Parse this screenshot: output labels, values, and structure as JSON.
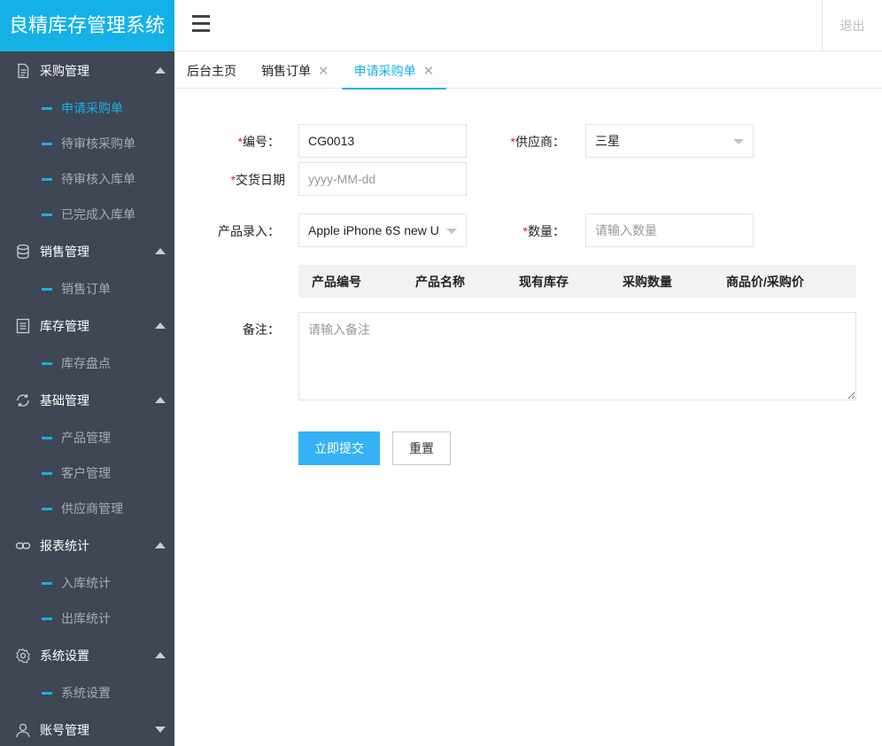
{
  "app": {
    "title": "良精库存管理系统",
    "logout": "退出"
  },
  "sidebar": {
    "groups": [
      {
        "label": "采购管理",
        "icon": "document-icon",
        "expanded": true,
        "items": [
          {
            "label": "申请采购单",
            "active": true
          },
          {
            "label": "待审核采购单"
          },
          {
            "label": "待审核入库单"
          },
          {
            "label": "已完成入库单"
          }
        ]
      },
      {
        "label": "销售管理",
        "icon": "database-icon",
        "expanded": true,
        "items": [
          {
            "label": "销售订单"
          }
        ]
      },
      {
        "label": "库存管理",
        "icon": "list-icon",
        "expanded": true,
        "items": [
          {
            "label": "库存盘点"
          }
        ]
      },
      {
        "label": "基础管理",
        "icon": "refresh-icon",
        "expanded": true,
        "items": [
          {
            "label": "产品管理"
          },
          {
            "label": "客户管理"
          },
          {
            "label": "供应商管理"
          }
        ]
      },
      {
        "label": "报表统计",
        "icon": "link-icon",
        "expanded": true,
        "items": [
          {
            "label": "入库统计"
          },
          {
            "label": "出库统计"
          }
        ]
      },
      {
        "label": "系统设置",
        "icon": "gear-icon",
        "expanded": true,
        "items": [
          {
            "label": "系统设置"
          }
        ]
      },
      {
        "label": "账号管理",
        "icon": "user-icon",
        "expanded": false,
        "items": []
      }
    ]
  },
  "tabs": [
    {
      "label": "后台主页",
      "closable": false,
      "active": false
    },
    {
      "label": "销售订单",
      "closable": true,
      "active": false
    },
    {
      "label": "申请采购单",
      "closable": true,
      "active": true
    }
  ],
  "form": {
    "code": {
      "label": "编号：",
      "value": "CG0013"
    },
    "supplier": {
      "label": "供应商：",
      "value": "三星"
    },
    "delivery_date": {
      "label": "交货日期",
      "placeholder": "yyyy-MM-dd"
    },
    "product": {
      "label": "产品录入：",
      "value": "Apple iPhone 6S new U"
    },
    "quantity": {
      "label": "数量：",
      "placeholder": "请输入数量"
    },
    "table_headers": [
      "产品编号",
      "产品名称",
      "现有库存",
      "采购数量",
      "商品价/采购价"
    ],
    "note": {
      "label": "备注：",
      "placeholder": "请输入备注"
    },
    "submit_label": "立即提交",
    "reset_label": "重置"
  },
  "colors": {
    "accent": "#14b1e8",
    "sidebar": "#3f4654",
    "primary_button": "#35b1f5"
  }
}
